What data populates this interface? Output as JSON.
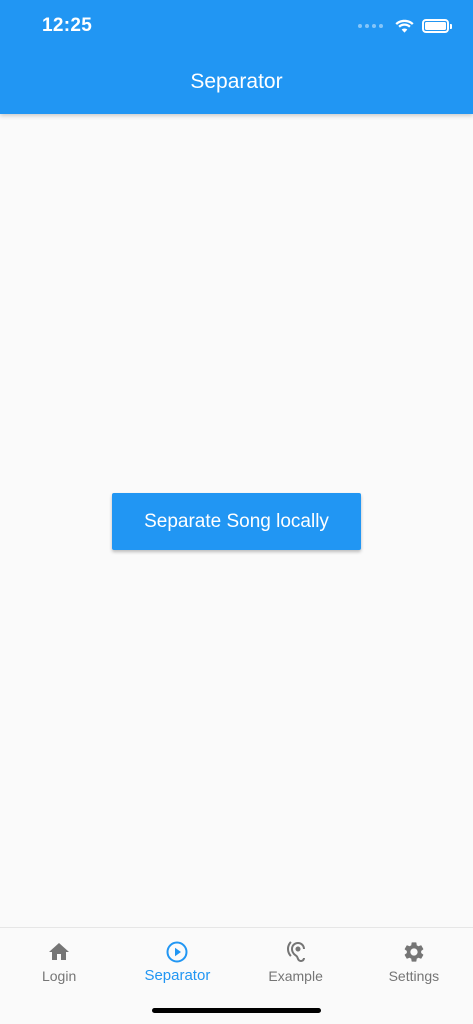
{
  "status_bar": {
    "time": "12:25"
  },
  "app_bar": {
    "title": "Separator",
    "color": "#2196f3"
  },
  "main": {
    "separate_button_label": "Separate Song locally"
  },
  "bottom_nav": {
    "active_color": "#2196f3",
    "inactive_color": "#757575",
    "items": [
      {
        "label": "Login",
        "icon": "home-icon",
        "active": false
      },
      {
        "label": "Separator",
        "icon": "play-circle-icon",
        "active": true
      },
      {
        "label": "Example",
        "icon": "hearing-icon",
        "active": false
      },
      {
        "label": "Settings",
        "icon": "gear-icon",
        "active": false
      }
    ]
  }
}
